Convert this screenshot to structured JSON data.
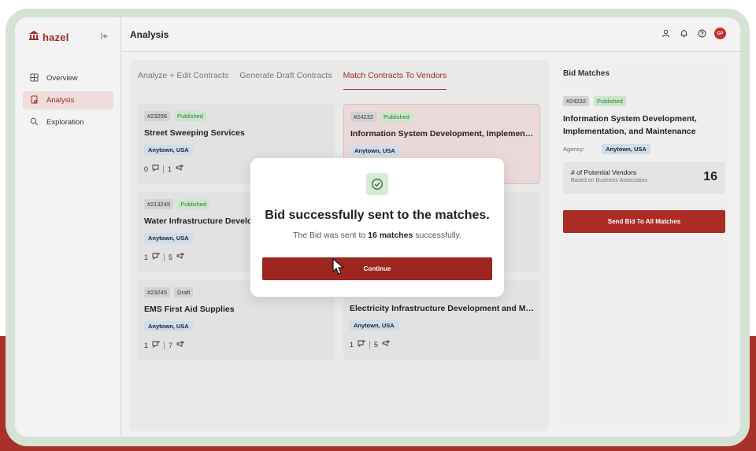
{
  "app": {
    "name": "hazel"
  },
  "sidebar": {
    "items": [
      {
        "label": "Overview",
        "icon": "grid-icon",
        "active": false
      },
      {
        "label": "Analysis",
        "icon": "document-icon",
        "active": true
      },
      {
        "label": "Exploration",
        "icon": "search-icon",
        "active": false
      }
    ]
  },
  "header": {
    "title": "Analysis",
    "avatar_initials": "GP"
  },
  "tabs": [
    {
      "label": "Analyze + Edit Contracts",
      "active": false
    },
    {
      "label": "Generate Draft Contracts",
      "active": false
    },
    {
      "label": "Match Contracts To Vendors",
      "active": true
    }
  ],
  "cards": [
    {
      "id": "#23256",
      "status": "Published",
      "title": "Street Sweeping Services",
      "location": "Anytown, USA",
      "comments": "0",
      "flags": "1"
    },
    {
      "id": "#24232",
      "status": "Published",
      "title": "Information System Development, Implementation, and Maintenance",
      "location": "Anytown, USA",
      "comments": "",
      "flags": ""
    },
    {
      "id": "#213245",
      "status": "Published",
      "title": "Water Infrastructure Development",
      "location": "Anytown, USA",
      "comments": "1",
      "flags": "5"
    },
    {
      "id": "",
      "status": "",
      "title": "",
      "location": "",
      "comments": "",
      "flags": ""
    },
    {
      "id": "#23245",
      "status": "Draft",
      "title": "EMS First Aid Supplies",
      "location": "Anytown, USA",
      "comments": "1",
      "flags": "7"
    },
    {
      "id": "",
      "status": "",
      "title": "Electricity Infrastructure Development and Maintenance",
      "location": "Anytown, USA",
      "comments": "1",
      "flags": "5"
    }
  ],
  "bid_matches": {
    "title": "Bid Matches",
    "id": "#24232",
    "status": "Published",
    "name": "Information System Development, Implementation, and Maintenance",
    "agency_label": "Agency:",
    "agency_value": "Anytown, USA",
    "vendors_label": "# of Potential Vendors",
    "vendors_sub": "Based on Business Association",
    "vendors_count": "16",
    "send_button": "Send Bid To All Matches"
  },
  "modal": {
    "title": "Bid successfully sent to the matches.",
    "message_prefix": "The Bid was sent to ",
    "message_bold": "16 matches",
    "message_suffix": " successfully.",
    "button": "Continue"
  },
  "colors": {
    "accent": "#9c2b25",
    "published_bg": "#cce6cc",
    "location_bg": "#cfdcea"
  }
}
